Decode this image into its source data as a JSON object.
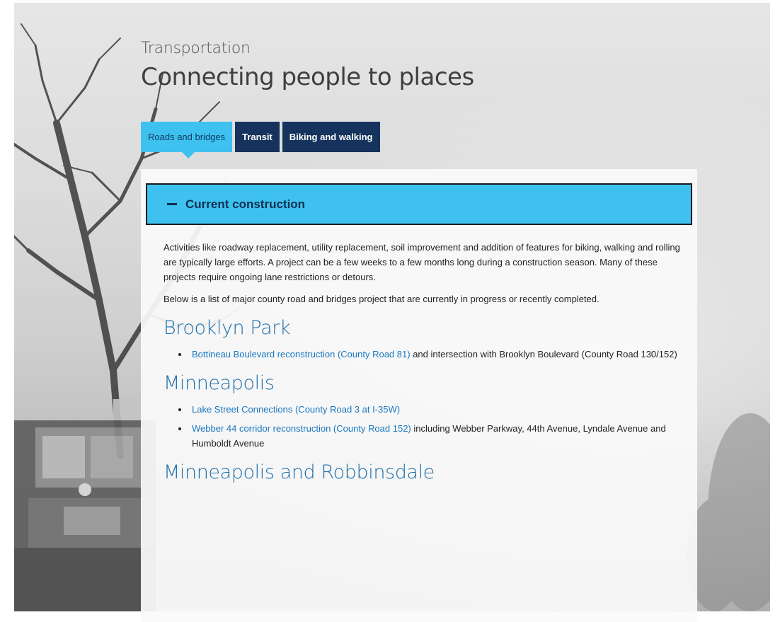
{
  "header": {
    "eyebrow": "Transportation",
    "title": "Connecting people to places"
  },
  "tabs": [
    {
      "label": "Roads and bridges",
      "active": true
    },
    {
      "label": "Transit",
      "active": false
    },
    {
      "label": "Biking and walking",
      "active": false
    }
  ],
  "accordion": {
    "icon": "minus-icon",
    "title": "Current construction",
    "expanded": true
  },
  "intro": [
    "Activities like roadway replacement, utility replacement, soil improvement and addition of features for biking, walking and rolling are typically large efforts. A project can be a few weeks to a few months long during a construction season. Many of these projects require ongoing lane restrictions or detours.",
    "Below is a list of major county road and bridges project that are currently in progress or recently completed."
  ],
  "regions": [
    {
      "name": "Brooklyn Park",
      "projects": [
        {
          "link": "Bottineau Boulevard reconstruction (County Road 81)",
          "suffix": " and intersection with Brooklyn Boulevard (County Road 130/152)"
        }
      ]
    },
    {
      "name": "Minneapolis",
      "projects": [
        {
          "link": "Lake Street Connections (County Road 3 at I-35W)",
          "suffix": ""
        },
        {
          "link": "Webber 44 corridor reconstruction (County Road 152)",
          "suffix": " including Webber Parkway, 44th Avenue, Lyndale Avenue and Humboldt Avenue"
        }
      ]
    },
    {
      "name": "Minneapolis and Robbinsdale",
      "projects": []
    }
  ],
  "colors": {
    "active_tab": "#3ec1ef",
    "inactive_tab": "#15335c",
    "link": "#1877c1",
    "region_heading": "#1f6faa"
  }
}
